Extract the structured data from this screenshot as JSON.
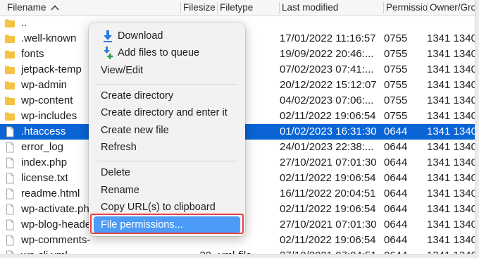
{
  "columns": {
    "filename": "Filename",
    "filesize": "Filesize",
    "filetype": "Filetype",
    "last_modified": "Last modified",
    "permissions": "Permission",
    "owner_group": "Owner/Grou"
  },
  "rows": [
    {
      "name": "..",
      "icon": "folder-icon",
      "size": "",
      "type": "",
      "modified": "",
      "perms": "",
      "owner": ""
    },
    {
      "name": ".well-known",
      "icon": "folder-icon",
      "size": "",
      "type": "ory",
      "modified": "17/01/2022 11:16:57",
      "perms": "0755",
      "owner": "1341 1340"
    },
    {
      "name": "fonts",
      "icon": "folder-icon",
      "size": "",
      "type": "ory",
      "modified": "19/09/2022 20:46:...",
      "perms": "0755",
      "owner": "1341 1340"
    },
    {
      "name": "jetpack-temp",
      "icon": "folder-icon",
      "size": "",
      "type": "ory",
      "modified": "07/02/2023 07:41:...",
      "perms": "0755",
      "owner": "1341 1340"
    },
    {
      "name": "wp-admin",
      "icon": "folder-icon",
      "size": "",
      "type": "ory",
      "modified": "20/12/2022 15:12:07",
      "perms": "0755",
      "owner": "1341 1340"
    },
    {
      "name": "wp-content",
      "icon": "folder-icon",
      "size": "",
      "type": "ory",
      "modified": "04/02/2023 07:06:...",
      "perms": "0755",
      "owner": "1341 1340"
    },
    {
      "name": "wp-includes",
      "icon": "folder-icon",
      "size": "",
      "type": "ory",
      "modified": "02/11/2022 19:06:54",
      "perms": "0755",
      "owner": "1341 1340"
    },
    {
      "name": ".htaccess",
      "icon": "file-icon",
      "size": "",
      "type": "",
      "modified": "01/02/2023 16:31:30",
      "perms": "0644",
      "owner": "1341 1340"
    },
    {
      "name": "error_log",
      "icon": "file-icon",
      "size": "",
      "type": "",
      "modified": "24/01/2023 22:38:...",
      "perms": "0644",
      "owner": "1341 1340"
    },
    {
      "name": "index.php",
      "icon": "file-icon",
      "size": "",
      "type": "le",
      "modified": "27/10/2021 07:01:30",
      "perms": "0644",
      "owner": "1341 1340"
    },
    {
      "name": "license.txt",
      "icon": "file-icon",
      "size": "",
      "type": "e",
      "modified": "02/11/2022 19:06:54",
      "perms": "0644",
      "owner": "1341 1340"
    },
    {
      "name": "readme.html",
      "icon": "file-icon",
      "size": "",
      "type": "do...",
      "modified": "16/11/2022 20:04:51",
      "perms": "0644",
      "owner": "1341 1340"
    },
    {
      "name": "wp-activate.ph",
      "icon": "file-icon",
      "size": "",
      "type": "",
      "modified": "02/11/2022 19:06:54",
      "perms": "0644",
      "owner": "1341 1340"
    },
    {
      "name": "wp-blog-heade",
      "icon": "file-icon",
      "size": "",
      "type": "",
      "modified": "27/10/2021 07:01:30",
      "perms": "0644",
      "owner": "1341 1340"
    },
    {
      "name": "wp-comments-",
      "icon": "file-icon",
      "size": "",
      "type": "",
      "modified": "02/11/2022 19:06:54",
      "perms": "0644",
      "owner": "1341 1340"
    },
    {
      "name": "wp-cli.yml",
      "icon": "file-icon",
      "size": "30",
      "type": "yml-file",
      "modified": "27/10/2021 07:04:51",
      "perms": "0644",
      "owner": "1341 1340"
    }
  ],
  "selected_row_index": 7,
  "context_menu": {
    "download": "Download",
    "add_to_queue": "Add files to queue",
    "view_edit": "View/Edit",
    "create_directory": "Create directory",
    "create_directory_enter": "Create directory and enter it",
    "create_new_file": "Create new file",
    "refresh": "Refresh",
    "delete": "Delete",
    "rename": "Rename",
    "copy_url": "Copy URL(s) to clipboard",
    "file_permissions": "File permissions..."
  },
  "colors": {
    "selection": "#0a64d6",
    "menu_highlight": "#4c9cf7",
    "annotation_outline": "#e9413f",
    "folder": "#f6c244",
    "download_arrow": "#2b7de0",
    "queue_icon": "#2e9e57"
  }
}
